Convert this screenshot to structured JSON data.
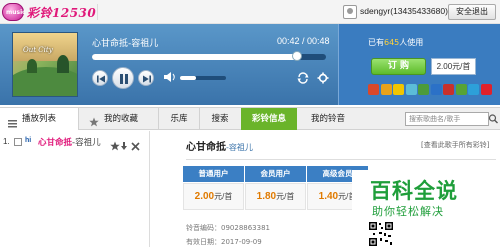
{
  "topbar": {
    "logo_badge": "music",
    "logo_text": "彩铃12530",
    "user_name": "sdengyr(13435433680)",
    "logout_label": "安全退出"
  },
  "player": {
    "album_title": "Out City",
    "song_title": "心甘命抵-容祖儿",
    "current_time": "00:42",
    "total_time": "00:48",
    "time_display": "00:42 / 00:48",
    "progress_fraction": 0.875,
    "volume_fraction": 0.35,
    "icons": [
      "prev-icon",
      "pause-icon",
      "next-icon",
      "volume-icon",
      "repeat-icon",
      "settings-icon"
    ]
  },
  "right_panel": {
    "users_prefix": "已有",
    "users_count": "645",
    "users_suffix": "人使用",
    "buy_label": "订 购",
    "price": "2.00元/首",
    "social_colors": [
      "#d9482b",
      "#e8a21a",
      "#f1c500",
      "#5bbcd8",
      "#4c9b3a",
      "#2b71c7",
      "#c9302c",
      "#57a336",
      "#2da0d9",
      "#e0212b"
    ]
  },
  "tabs": [
    {
      "label": "播放列表",
      "icon": "playlist-icon"
    },
    {
      "label": "我的收藏",
      "icon": "star-icon"
    },
    {
      "label": "乐库"
    },
    {
      "label": "搜索"
    },
    {
      "label": "彩铃信息"
    },
    {
      "label": "我的铃音"
    }
  ],
  "search": {
    "placeholder": "搜索歌曲名/歌手"
  },
  "playlist": [
    {
      "index": "1.",
      "badge": "hi",
      "title": "心甘命抵",
      "artist": "-容祖儿"
    }
  ],
  "detail": {
    "title": "心甘命抵",
    "artist": "-容祖儿",
    "more_link": "[查看此歌手所有彩铃]",
    "price_table": {
      "headers": [
        "普通用户",
        "会员用户",
        "高级会员"
      ],
      "values": [
        "2.00",
        "1.80",
        "1.40"
      ],
      "unit": "元/首"
    },
    "code_label": "铃音编码：",
    "code_value": "09028863381",
    "expire_label": "有效日期：",
    "expire_value": "2017-09-09"
  },
  "watermark": {
    "title": "百科全说",
    "subtitle": "助你轻松解决"
  }
}
